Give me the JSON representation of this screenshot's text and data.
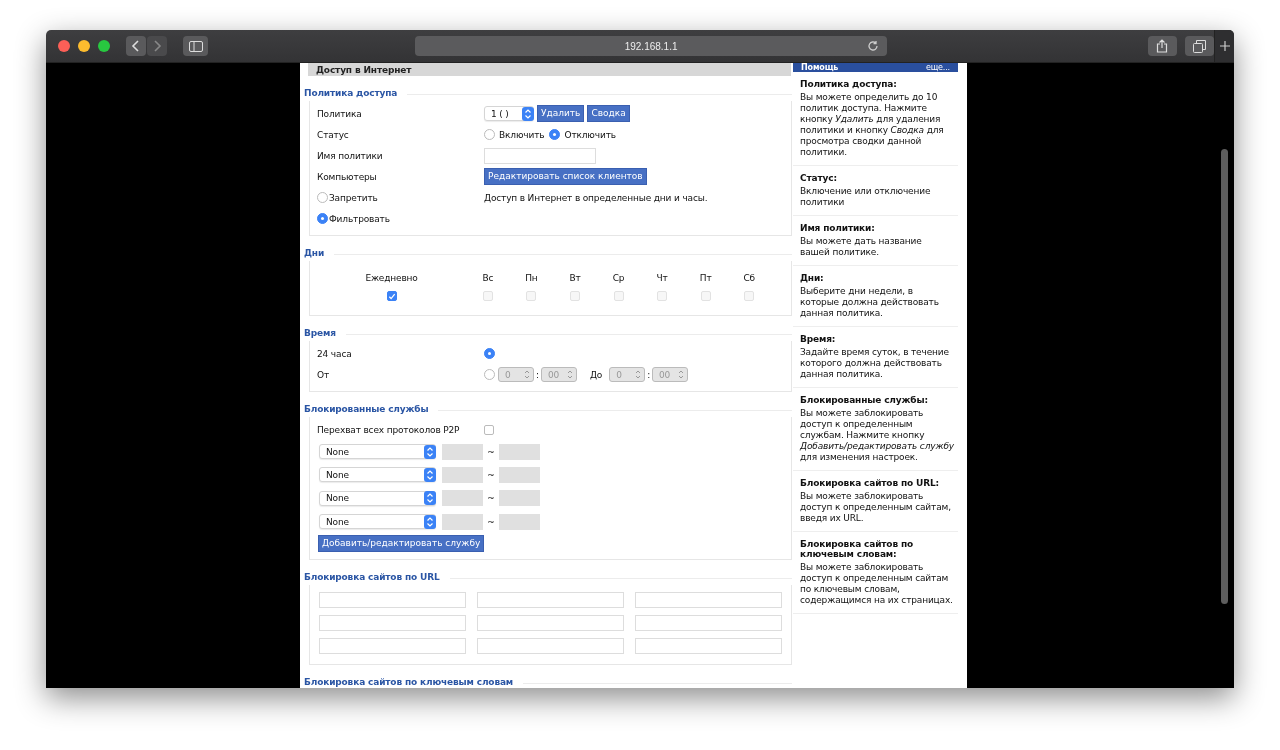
{
  "browser": {
    "url": "192.168.1.1"
  },
  "page": {
    "title": "Доступ в Интернет"
  },
  "access_policy": {
    "title": "Политика доступа",
    "policy_label": "Политика",
    "policy_value": "1 ( )",
    "delete_button": "Удалить",
    "summary_button": "Сводка",
    "status_label": "Статус",
    "status_options": [
      {
        "label": "Включить",
        "selected": false
      },
      {
        "label": "Отключить",
        "selected": true
      }
    ],
    "name_label": "Имя политики",
    "computers_label": "Компьютеры",
    "edit_clients_button": "Редактировать список клиентов",
    "modes": [
      {
        "label": "Запретить",
        "selected": false
      },
      {
        "label": "Фильтровать",
        "selected": true
      }
    ],
    "mode_note": "Доступ в Интернет в определенные дни и часы."
  },
  "days": {
    "title": "Дни",
    "items": [
      {
        "label": "Ежедневно",
        "checked": true,
        "disabled": false
      },
      {
        "label": "Вс",
        "checked": false,
        "disabled": true
      },
      {
        "label": "Пн",
        "checked": false,
        "disabled": true
      },
      {
        "label": "Вт",
        "checked": false,
        "disabled": true
      },
      {
        "label": "Ср",
        "checked": false,
        "disabled": true
      },
      {
        "label": "Чт",
        "checked": false,
        "disabled": true
      },
      {
        "label": "Пт",
        "checked": false,
        "disabled": true
      },
      {
        "label": "Сб",
        "checked": false,
        "disabled": true
      }
    ]
  },
  "time": {
    "title": "Время",
    "options": [
      {
        "kind": "all_day",
        "label": "24 часа",
        "selected": true
      },
      {
        "kind": "range",
        "label": "От",
        "selected": false
      }
    ],
    "from_hour": "0",
    "from_minute": "00",
    "colon": ":",
    "to_label": "До",
    "to_hour": "0",
    "to_minute": "00"
  },
  "blocked_services": {
    "title": "Блокированные службы",
    "p2p_label": "Перехват всех протоколов P2P",
    "p2p_checked": false,
    "services": [
      {
        "value": "None",
        "separator": "~"
      },
      {
        "value": "None",
        "separator": "~"
      },
      {
        "value": "None",
        "separator": "~"
      },
      {
        "value": "None",
        "separator": "~"
      }
    ],
    "add_button": "Добавить/редактировать службу"
  },
  "url_blocking": {
    "title": "Блокировка сайтов по URL"
  },
  "keyword_blocking": {
    "title": "Блокировка сайтов по ключевым словам"
  },
  "help": {
    "title": "Помощь",
    "more": "еще...",
    "sections": [
      {
        "title": "Политика доступа:",
        "text": "Вы можете определить до 10 политик доступа. Нажмите кнопку *Удалить* для удаления политики и кнопку *Сводка* для просмотра сводки данной политики."
      },
      {
        "title": "Статус:",
        "text": "Включение или отключение политики"
      },
      {
        "title": "Имя политики:",
        "text": "Вы можете дать название вашей политике."
      },
      {
        "title": "Дни:",
        "text": "Выберите дни недели, в которые должна действовать данная политика."
      },
      {
        "title": "Время:",
        "text": "Задайте время суток, в течение которого должна действовать данная политика."
      },
      {
        "title": "Блокированные службы:",
        "text": "Вы можете заблокировать доступ к определенным службам. Нажмите кнопку *Добавить/редактировать службу* для изменения настроек."
      },
      {
        "title": "Блокировка сайтов по URL:",
        "text": "Вы можете заблокировать доступ к определенным сайтам, введя их URL."
      },
      {
        "title": "Блокировка сайтов по ключевым словам:",
        "text": "Вы можете заблокировать доступ к определенным сайтам по ключевым словам, содержащимся на их страницах."
      }
    ]
  }
}
